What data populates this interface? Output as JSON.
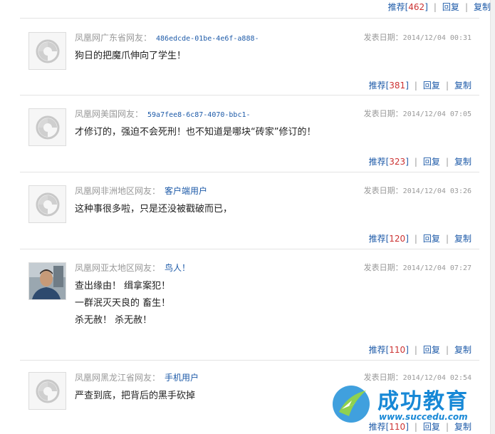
{
  "labels": {
    "recommend": "推荐",
    "reply": "回复",
    "copy": "复制",
    "date_label": "发表日期："
  },
  "top_actions": {
    "recommend_count": "462"
  },
  "comments": [
    {
      "source": "凤凰网广东省网友：",
      "user": "486edcde-01be-4e6f-a888-",
      "date": "2014/12/04 00:31",
      "lines": [
        "狗日的把魔爪伸向了学生！"
      ],
      "recommend_count": "381"
    },
    {
      "source": "凤凰网美国网友：",
      "user": "59a7fee8-6c87-4070-bbc1-",
      "date": "2014/12/04 07:05",
      "lines": [
        "才修订的，强迫不会死刑！也不知道是哪块“砖家”修订的！"
      ],
      "recommend_count": "323"
    },
    {
      "source": "凤凰网非洲地区网友：",
      "user": "客户端用户",
      "date": "2014/12/04 03:26",
      "lines": [
        "这种事很多啦，只是还没被戳破而已，"
      ],
      "recommend_count": "120"
    },
    {
      "source": "凤凰网亚太地区网友：",
      "user": "鸟人！",
      "date": "2014/12/04 07:27",
      "lines": [
        "查出缘由！ 缉拿案犯！",
        "一群泯灭天良的 畜生！",
        "杀无赦！ 杀无赦！"
      ],
      "recommend_count": "110"
    },
    {
      "source": "凤凰网黑龙江省网友：",
      "user": "手机用户",
      "date": "2014/12/04 02:54",
      "lines": [
        "严查到底，把背后的黑手砍掉"
      ],
      "recommend_count": "110"
    }
  ],
  "watermark": {
    "title": "成功教育",
    "url": "www.succedu.com"
  }
}
